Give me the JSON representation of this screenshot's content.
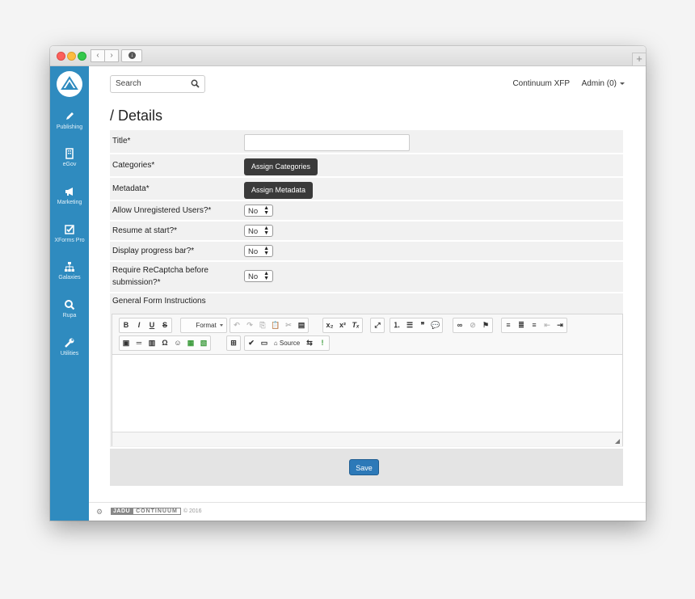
{
  "browser": {
    "back_glyph": "‹",
    "forward_glyph": "›",
    "download_glyph": "↓",
    "plus_glyph": "+"
  },
  "sidebar": {
    "items": [
      {
        "label": "Publishing",
        "icon": "pencil-icon"
      },
      {
        "label": "eGov",
        "icon": "building-icon"
      },
      {
        "label": "Marketing",
        "icon": "megaphone-icon"
      },
      {
        "label": "XForms Pro",
        "icon": "checkbox-icon"
      },
      {
        "label": "Galaxies",
        "icon": "sitemap-icon"
      },
      {
        "label": "Rupa",
        "icon": "search-icon"
      },
      {
        "label": "Utilities",
        "icon": "wrench-icon"
      }
    ],
    "color": "#2f8bbf"
  },
  "header": {
    "search_placeholder": "Search",
    "site_name": "Continuum XFP",
    "user_menu": "Admin (0)"
  },
  "page": {
    "title": "/ Details"
  },
  "form": {
    "title_label": "Title*",
    "title_value": "",
    "categories_label": "Categories*",
    "categories_button": "Assign Categories",
    "metadata_label": "Metadata*",
    "metadata_button": "Assign Metadata",
    "unregistered_label": "Allow Unregistered Users?*",
    "unregistered_value": "No",
    "resume_label": "Resume at start?*",
    "resume_value": "No",
    "progress_label": "Display progress bar?*",
    "progress_value": "No",
    "recaptcha_label": "Require ReCaptcha before submission?*",
    "recaptcha_value": "No",
    "instructions_label": "General Form Instructions",
    "save_label": "Save"
  },
  "editor": {
    "format_label": "Format",
    "source_label": "Source",
    "glyphs": {
      "bold": "B",
      "italic": "I",
      "underline": "U",
      "strike": "S",
      "undo": "↶",
      "redo": "↷",
      "copy": "⎘",
      "paste": "📋",
      "cut": "✂",
      "pasteword": "▤",
      "subscript": "x₂",
      "superscript": "x²",
      "removeformat": "Tₓ",
      "maximize": "⤢",
      "numlist": "⒈",
      "bulletlist": "☰",
      "blockquote": "❞",
      "comment": "💬",
      "link": "∞",
      "unlink": "⊘",
      "anchor": "⚑",
      "align_left": "≡",
      "align_center": "≣",
      "align_right": "≡",
      "outdent": "⇤",
      "indent": "⇥",
      "image": "▣",
      "hr": "═",
      "pagebreak": "▥",
      "omega": "Ω",
      "smiley": "☺",
      "iframe": "▦",
      "template": "▧",
      "table": "⊞",
      "spellcheck": "✔",
      "find": "▭",
      "source_icon": "⌂",
      "showblocks": "⇆",
      "info": "!"
    }
  },
  "footer": {
    "settings_glyph": "⚙",
    "brand_a": "JADU",
    "brand_b": "CONTINUUM",
    "copyright": "© 2016"
  }
}
